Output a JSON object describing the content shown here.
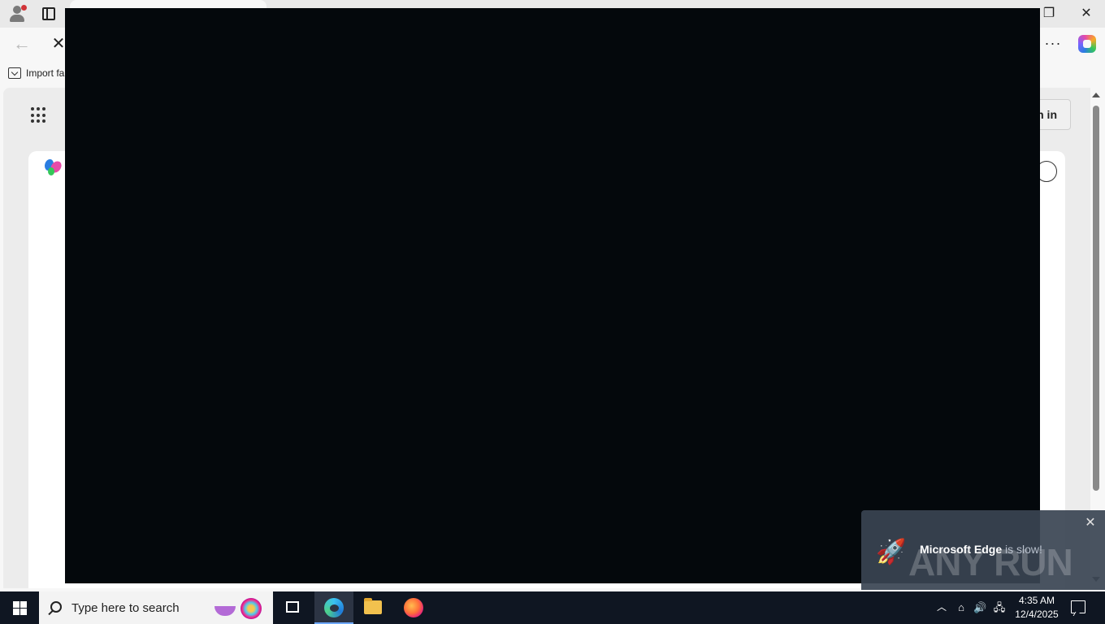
{
  "browser": {
    "favorites": {
      "import_label": "Import fa"
    },
    "page": {
      "signin_label": "n in"
    }
  },
  "toast": {
    "app": "Microsoft Edge",
    "message": " is slow!",
    "watermark": "ANY RUN"
  },
  "taskbar": {
    "search_placeholder": "Type here to search",
    "time": "4:35 AM",
    "date": "12/4/2025"
  },
  "colors": {
    "overlay": "#04080c",
    "taskbar": "#0f1622",
    "accent": "#6ea8ff"
  }
}
